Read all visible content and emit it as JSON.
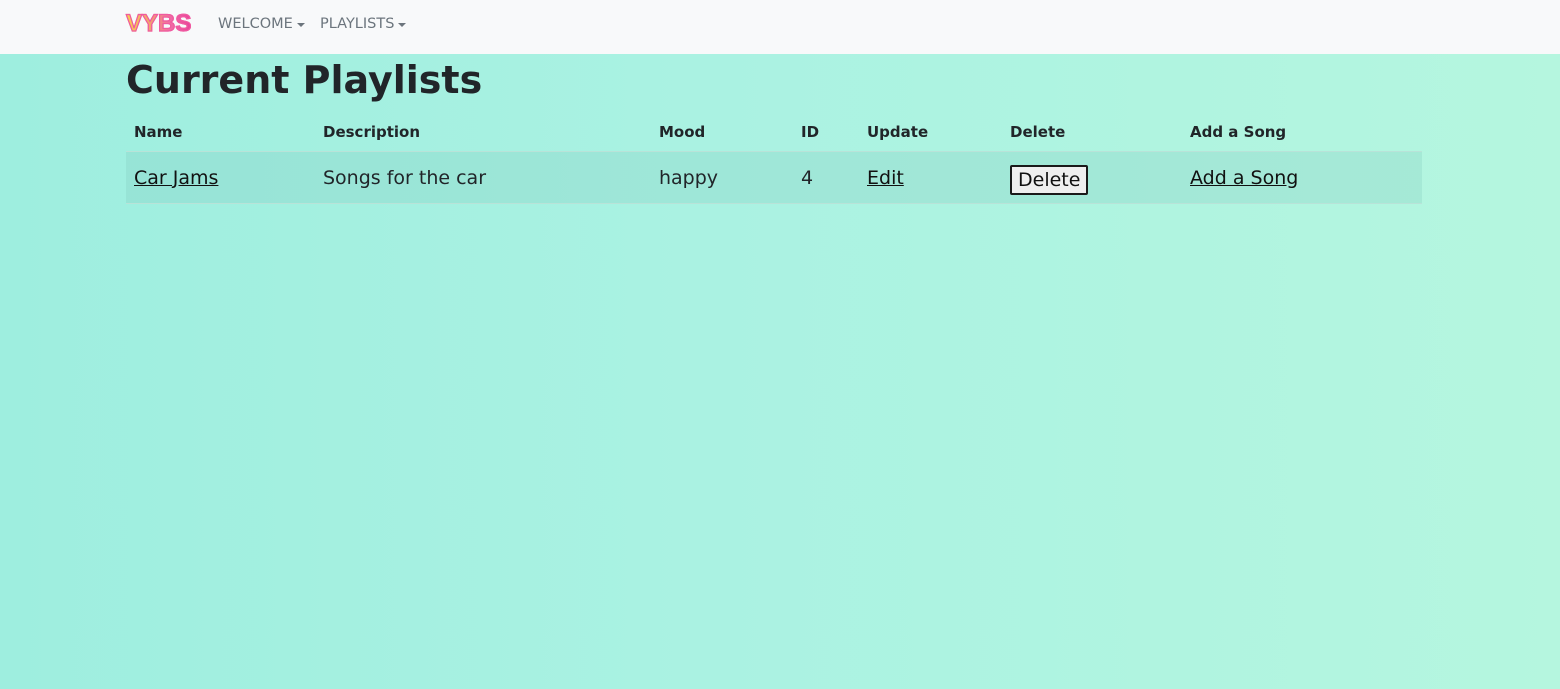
{
  "brand": {
    "name": "VYBS"
  },
  "nav": {
    "welcome": "WELCOME",
    "playlists": "PLAYLISTS"
  },
  "page": {
    "title": "Current Playlists"
  },
  "table": {
    "headers": [
      "Name",
      "Description",
      "Mood",
      "ID",
      "Update",
      "Delete",
      "Add a Song"
    ],
    "rows": [
      {
        "name": "Car Jams",
        "description": "Songs for the car",
        "mood": "happy",
        "id": "4",
        "update": "Edit",
        "delete": "Delete",
        "add_song": "Add a Song"
      }
    ]
  },
  "colors": {
    "navbar_bg": "#f8f9fa",
    "page_bg_start": "#9eeedf",
    "page_bg_end": "#b5f6df",
    "brand_gradient": [
      "#f7d34c",
      "#f06aa5"
    ]
  }
}
